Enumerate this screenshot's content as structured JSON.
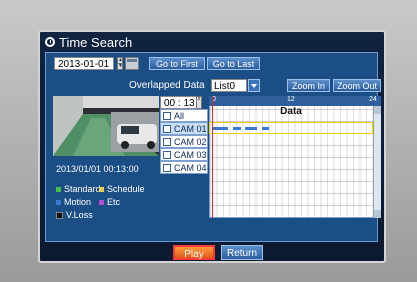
{
  "title": "Time Search",
  "date": "2013-01-01",
  "buttons": {
    "go_first": "Go to First",
    "go_last": "Go to Last",
    "zoom_in": "Zoom In",
    "zoom_out": "Zoom Out",
    "play": "Play",
    "return": "Return"
  },
  "overlap_label": "Overlapped Data",
  "overlap_value": "List0",
  "time": "00 : 13",
  "timestamp": "2013/01/01 00:13:00",
  "legend": [
    {
      "label": "Standard",
      "color": "#45c04a"
    },
    {
      "label": "Schedule",
      "color": "#e5d25c"
    },
    {
      "label": "Motion",
      "color": "#3a78d4"
    },
    {
      "label": "Etc",
      "color": "#b54fd1"
    },
    {
      "label": "V.Loss",
      "color": "#111111"
    }
  ],
  "cams": [
    "All",
    "CAM 01",
    "CAM 02",
    "CAM 03",
    "CAM 04"
  ],
  "ruler": [
    "0",
    "12",
    "24"
  ],
  "data_header": "Data",
  "colors": {
    "accent": "#1c4e86",
    "play": "#e66b1f"
  }
}
